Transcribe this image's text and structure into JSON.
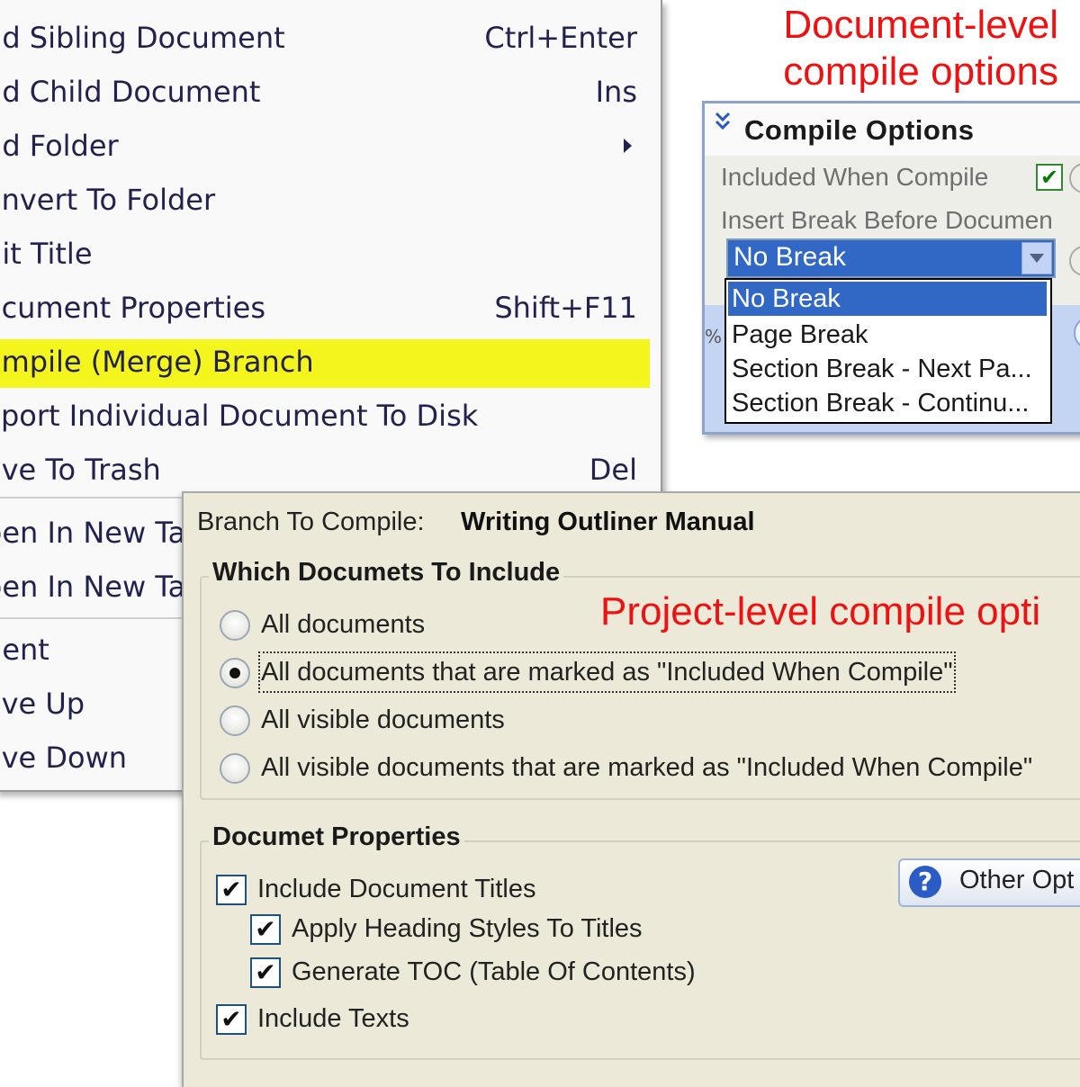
{
  "context_menu": {
    "items": [
      {
        "label": "dd Sibling Document",
        "shortcut": "Ctrl+Enter"
      },
      {
        "label": "dd Child Document",
        "shortcut": "Ins"
      },
      {
        "label": "dd Folder",
        "shortcut": ""
      },
      {
        "label": "onvert To Folder",
        "shortcut": ""
      },
      {
        "label": "dit Title",
        "shortcut": ""
      },
      {
        "label": "ocument Properties",
        "shortcut": "Shift+F11"
      },
      {
        "label": "ompile (Merge) Branch",
        "shortcut": ""
      },
      {
        "label": "xport Individual Document To Disk",
        "shortcut": ""
      },
      {
        "label": "ove To Trash",
        "shortcut": "Del"
      },
      {
        "label": "pen In New Ta",
        "shortcut": ""
      },
      {
        "label": "pen In New Ta",
        "shortcut": ""
      },
      {
        "label": "dent",
        "shortcut": ""
      },
      {
        "label": "ove Up",
        "shortcut": ""
      },
      {
        "label": "ove Down",
        "shortcut": ""
      }
    ],
    "highlight_color": "#f5f51e"
  },
  "annotations": {
    "document_level_line1": "Document-level",
    "document_level_line2": "compile options",
    "project_level": "Project-level compile opti",
    "color": "#ee1111"
  },
  "compile_options_panel": {
    "title": "Compile Options",
    "included_label": "Included When Compile",
    "included_checked": "✔",
    "insert_break_label": "Insert Break Before Documen",
    "selected_value": "No Break",
    "zoom_marker": "%",
    "dropdown_options": [
      "No Break",
      "Page Break",
      "Section Break - Next Pa...",
      "Section Break - Continu..."
    ]
  },
  "compile_dialog": {
    "branch_label": "Branch To Compile:",
    "branch_value": "Writing Outliner Manual",
    "which_group_title": "Which Documets To Include",
    "radio_options": [
      "All documents",
      "All documents that are marked as \"Included When Compile\"",
      "All visible documents",
      "All visible documents that are marked as \"Included When Compile\""
    ],
    "props_group_title": "Documet Properties",
    "checkbox_mark": "✔",
    "checkboxes": [
      "Include Document Titles",
      "Apply Heading Styles To Titles",
      "Generate TOC (Table Of Contents)",
      "Include Texts"
    ],
    "other_button_label": "Other Opt",
    "other_button_icon": "?"
  }
}
